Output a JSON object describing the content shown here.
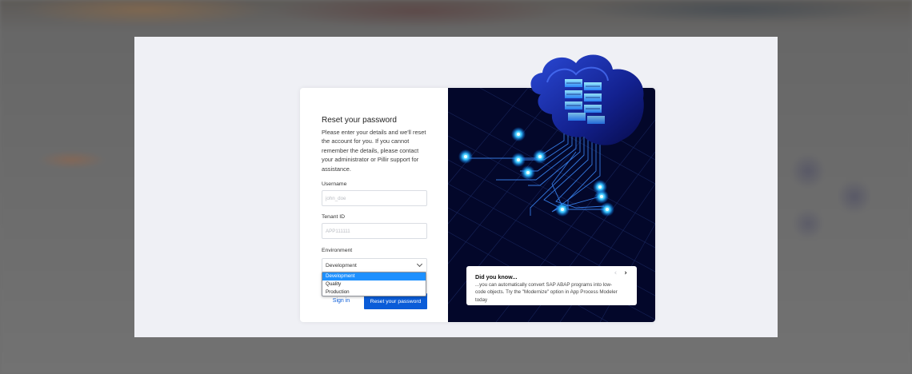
{
  "reset_form": {
    "title": "Reset your password",
    "description": "Please enter your details and we'll reset the account for you. If you cannot remember the details, please contact your administrator or Pillir support for assistance.",
    "username": {
      "label": "Username",
      "placeholder": "john_doe"
    },
    "tenant_id": {
      "label": "Tenant ID",
      "placeholder": "APP111111"
    },
    "environment": {
      "label": "Environment",
      "selected": "Development",
      "options": [
        "Development",
        "Quality",
        "Production"
      ]
    },
    "sign_in_label": "Sign in",
    "submit_label": "Reset your password"
  },
  "tip_card": {
    "title": "Did you know...",
    "text": "...you can automatically convert SAP ABAP programs into low-code objects. Try the \"Modernize\" option in App Process Modeler today",
    "prev_icon": "chevron-left-icon",
    "next_icon": "chevron-right-icon"
  },
  "colors": {
    "primary": "#0a5cd8",
    "art_background": "#03072a",
    "modal_background": "#eff0f5",
    "dropdown_highlight": "#1e90ff"
  }
}
